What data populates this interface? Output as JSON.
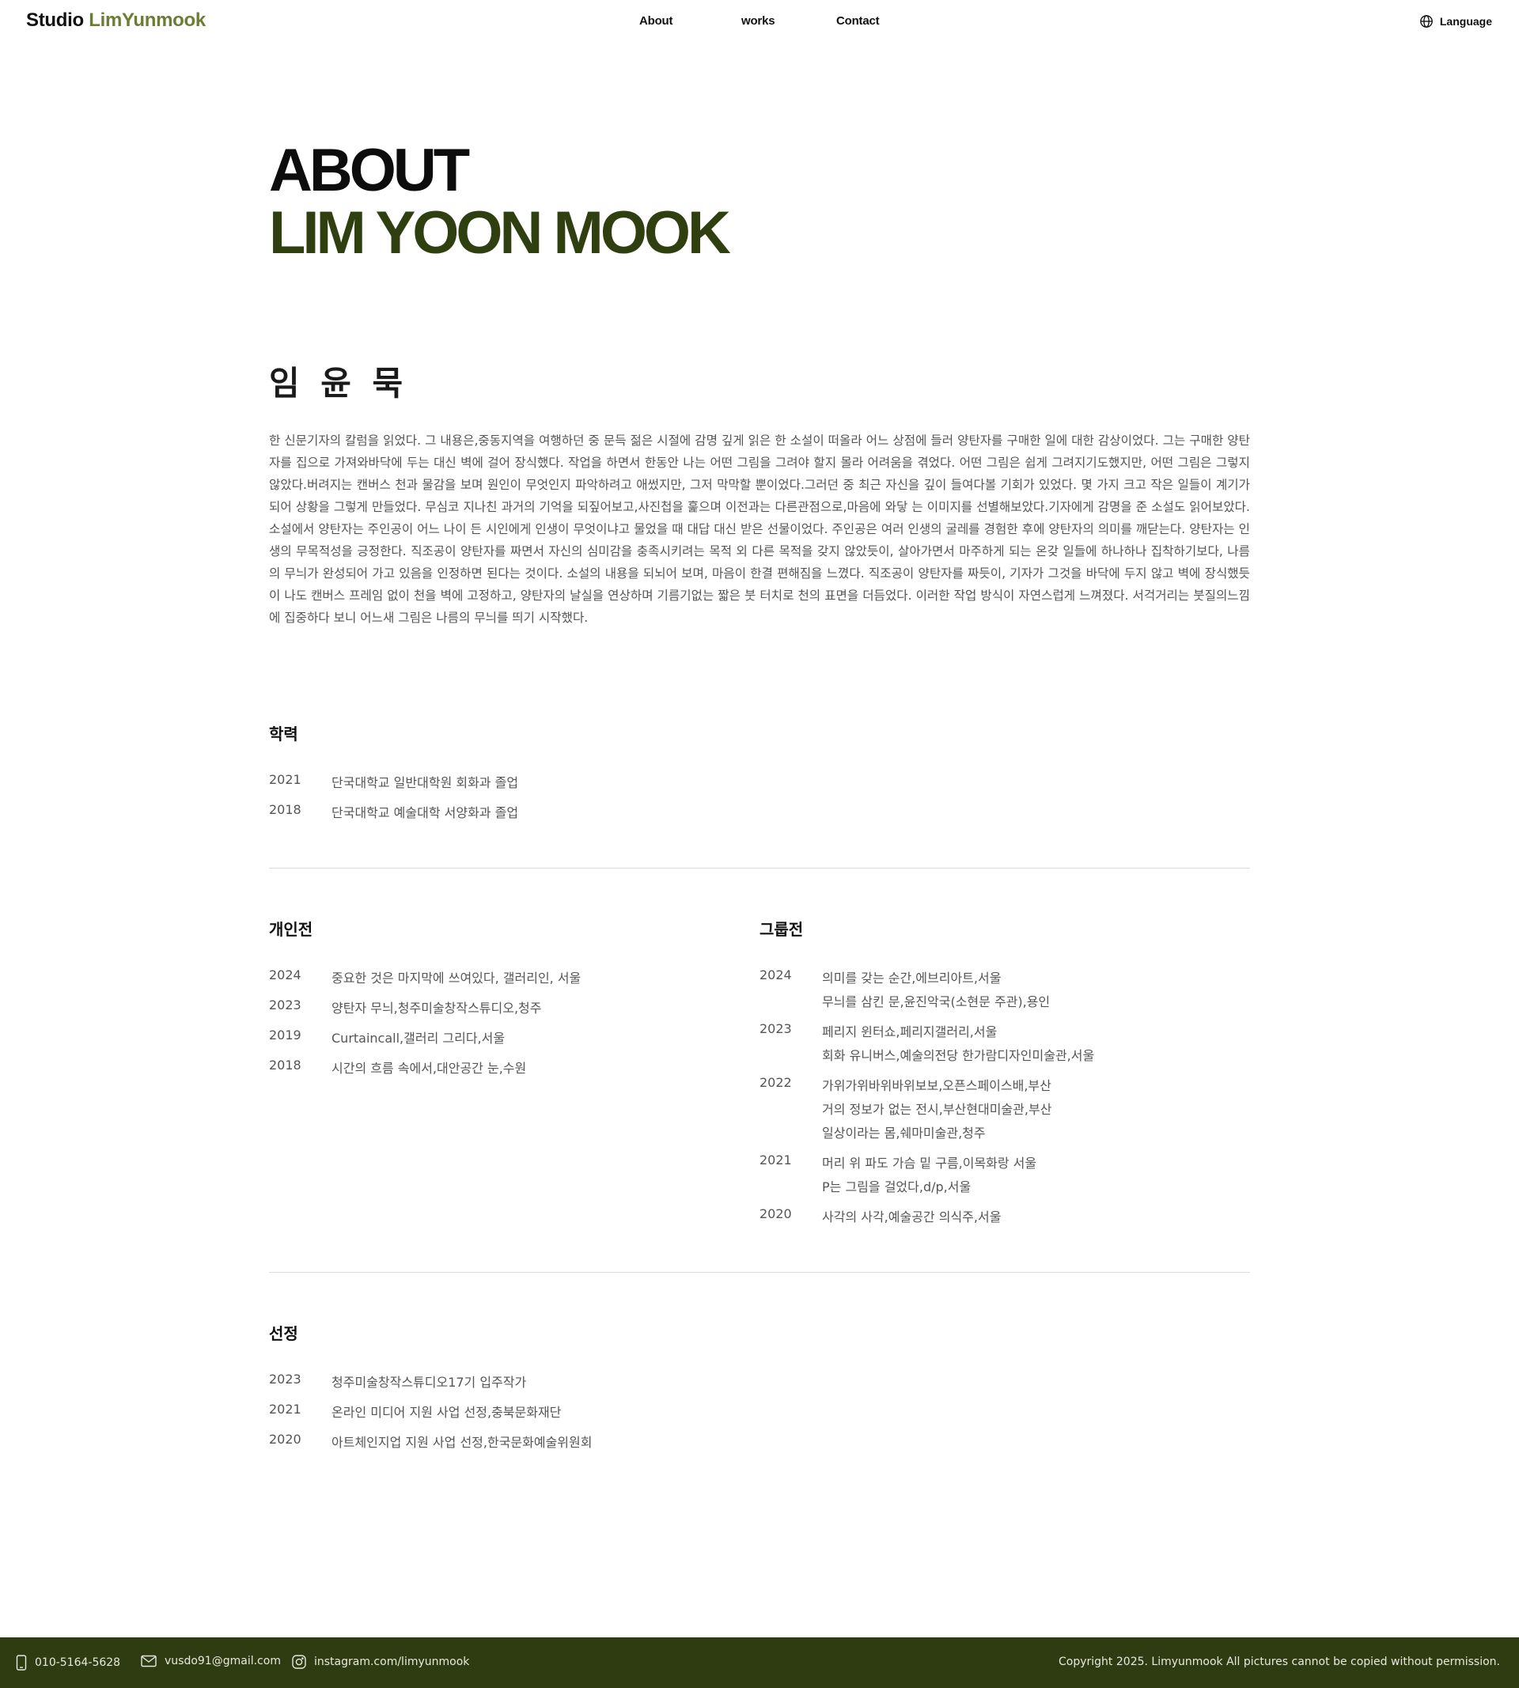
{
  "header": {
    "brand_prefix": "Studio",
    "brand_name": "LimYunmook",
    "nav": [
      "About",
      "works",
      "Contact"
    ],
    "language_label": "Language"
  },
  "hero": {
    "line1": "ABOUT",
    "line2": "LIM YOON MOOK"
  },
  "korean_name": "임 윤 묵",
  "bio": "한 신문기자의 칼럼을 읽었다. 그 내용은,중동지역을 여행하던 중 문득 젊은 시절에 감명 깊게 읽은 한 소설이 떠올라 어느 상점에 들러 양탄자를 구매한 일에 대한 감상이었다. 그는 구매한 양탄자를 집으로 가져와바닥에 두는 대신 벽에 걸어 장식했다. 작업을 하면서 한동안 나는 어떤 그림을 그려야 할지 몰라 어려움을 겪었다. 어떤 그림은 쉽게 그려지기도했지만, 어떤 그림은 그렇지 않았다.버려지는 캔버스 천과 물감을 보며 원인이 무엇인지 파악하려고 애썼지만, 그저 막막할 뿐이었다.그러던 중 최근 자신을 깊이 들여다볼 기회가 있었다. 몇 가지 크고 작은 일들이 계기가 되어 상황을 그렇게 만들었다. 무심코 지나친 과거의 기억을 되짚어보고,사진첩을 훑으며 이전과는 다른관점으로,마음에 와닿 는 이미지를 선별해보았다.기자에게 감명을 준 소설도 읽어보았다. 소설에서 양탄자는 주인공이 어느 나이 든 시인에게 인생이 무엇이냐고 물었을 때 대답 대신 받은 선물이었다. 주인공은 여러 인생의 굴레를 경험한 후에 양탄자의 의미를 깨닫는다. 양탄자는 인생의 무목적성을 긍정한다. 직조공이 양탄자를 짜면서 자신의 심미감을 충족시키려는 목적 외 다른 목적을 갖지 않았듯이, 살아가면서 마주하게 되는 온갖 일들에 하나하나 집착하기보다, 나름의 무늬가 완성되어 가고 있음을 인정하면 된다는 것이다. 소설의 내용을 되뇌어 보며, 마음이 한결 편해짐을 느꼈다. 직조공이 양탄자를 짜듯이, 기자가 그것을 바닥에 두지 않고 벽에 장식했듯이 나도 캔버스 프레임 없이 천을 벽에 고정하고, 양탄자의 날실을 연상하며 기름기없는 짧은 붓 터치로 천의 표면을 더듬었다. 이러한 작업 방식이 자연스럽게 느껴졌다. 서걱거리는 붓질의느낌에 집중하다 보니 어느새 그림은 나름의 무늬를 띄기 시작했다.",
  "education": {
    "title": "학력",
    "items": [
      {
        "year": "2021",
        "text": "단국대학교 일반대학원 회화과 졸업"
      },
      {
        "year": "2018",
        "text": "단국대학교 예술대학 서양화과 졸업"
      }
    ]
  },
  "solo": {
    "title": "개인전",
    "items": [
      {
        "year": "2024",
        "text": "중요한 것은 마지막에 쓰여있다, 갤러리인, 서울"
      },
      {
        "year": "2023",
        "text": "양탄자 무늬,청주미술창작스튜디오,청주"
      },
      {
        "year": "2019",
        "text": "Curtaincall,갤러리 그리다,서울"
      },
      {
        "year": "2018",
        "text": "시간의 흐름 속에서,대안공간 눈,수원"
      }
    ]
  },
  "group": {
    "title": "그룹전",
    "items": [
      {
        "year": "2024",
        "lines": [
          "의미를 갖는 순간,에브리아트,서울",
          "무늬를 삼킨 문,윤진악국(소현문 주관),용인"
        ]
      },
      {
        "year": "2023",
        "lines": [
          "페리지 윈터쇼,페리지갤러리,서울",
          "회화 유니버스,예술의전당 한가람디자인미술관,서울"
        ]
      },
      {
        "year": "2022",
        "lines": [
          "가위가위바위바위보보,오픈스페이스배,부산",
          "거의 정보가 없는 전시,부산현대미술관,부산",
          "일상이라는 몸,쉐마미술관,청주"
        ]
      },
      {
        "year": "2021",
        "lines": [
          "머리 위 파도 가슴 밑 구름,이목화랑 서울",
          "P는 그림을 걸었다,d/p,서울"
        ]
      },
      {
        "year": "2020",
        "lines": [
          "사각의 사각,예술공간 의식주,서울"
        ]
      }
    ]
  },
  "selection": {
    "title": "선정",
    "items": [
      {
        "year": "2023",
        "text": "청주미술창작스튜디오17기 입주작가"
      },
      {
        "year": "2021",
        "text": "온라인 미디어 지원 사업 선정,충북문화재단"
      },
      {
        "year": "2020",
        "text": "아트체인지업 지원 사업 선정,한국문화예술위원회"
      }
    ]
  },
  "footer": {
    "phone": "010-5164-5628",
    "email": "vusdo91@gmail.com",
    "instagram": "instagram.com/limyunmook",
    "copyright": "Copyright 2025. Limyunmook All pictures cannot be copied without permission."
  },
  "colors": {
    "accent_olive": "#6b7d35",
    "dark_olive": "#2f3f10",
    "footer_bg": "#2f3b11"
  }
}
